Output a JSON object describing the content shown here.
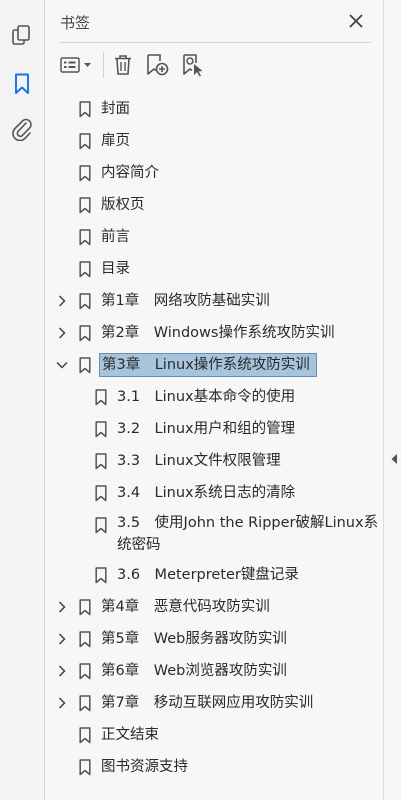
{
  "nav_rail": {
    "items": [
      {
        "name": "pages-icon"
      },
      {
        "name": "bookmark-icon",
        "active": true
      },
      {
        "name": "paperclip-icon"
      }
    ]
  },
  "panel": {
    "title": "书签",
    "close_icon": "close-icon",
    "toolbar": [
      "options-menu-icon",
      "delete-icon",
      "new-bookmark-icon",
      "bookmark-from-selection-icon"
    ]
  },
  "bookmarks": [
    {
      "label": "封面",
      "level": 0,
      "expandable": false
    },
    {
      "label": "扉页",
      "level": 0,
      "expandable": false
    },
    {
      "label": "内容简介",
      "level": 0,
      "expandable": false
    },
    {
      "label": "版权页",
      "level": 0,
      "expandable": false
    },
    {
      "label": "前言",
      "level": 0,
      "expandable": false
    },
    {
      "label": "目录",
      "level": 0,
      "expandable": false
    },
    {
      "label": "第1章　网络攻防基础实训",
      "level": 0,
      "expandable": true,
      "expanded": false
    },
    {
      "label": "第2章　Windows操作系统攻防实训",
      "level": 0,
      "expandable": true,
      "expanded": false
    },
    {
      "label": "第3章　Linux操作系统攻防实训",
      "level": 0,
      "expandable": true,
      "expanded": true,
      "selected": true
    },
    {
      "label": "3.1　Linux基本命令的使用",
      "level": 1,
      "expandable": false
    },
    {
      "label": "3.2　Linux用户和组的管理",
      "level": 1,
      "expandable": false
    },
    {
      "label": "3.3　Linux文件权限管理",
      "level": 1,
      "expandable": false
    },
    {
      "label": "3.4　Linux系统日志的清除",
      "level": 1,
      "expandable": false
    },
    {
      "label": "3.5　使用John the Ripper破解Linux系统密码",
      "level": 1,
      "expandable": false,
      "wrap": true
    },
    {
      "label": "3.6　Meterpreter键盘记录",
      "level": 1,
      "expandable": false
    },
    {
      "label": "第4章　恶意代码攻防实训",
      "level": 0,
      "expandable": true,
      "expanded": false
    },
    {
      "label": "第5章　Web服务器攻防实训",
      "level": 0,
      "expandable": true,
      "expanded": false
    },
    {
      "label": "第6章　Web浏览器攻防实训",
      "level": 0,
      "expandable": true,
      "expanded": false
    },
    {
      "label": "第7章　移动互联网应用攻防实训",
      "level": 0,
      "expandable": true,
      "expanded": false
    },
    {
      "label": "正文结束",
      "level": 0,
      "expandable": false
    },
    {
      "label": "图书资源支持",
      "level": 0,
      "expandable": false
    }
  ],
  "colors": {
    "accent": "#1473e6",
    "selection": "#a6c4dc",
    "icon": "#555555"
  }
}
